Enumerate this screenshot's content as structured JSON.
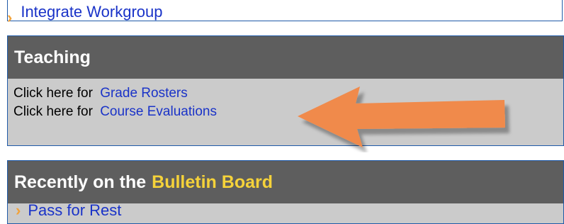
{
  "top": {
    "link": "Integrate Workgroup"
  },
  "teaching": {
    "title": "Teaching",
    "rows": [
      {
        "prefix": "Click here for",
        "link": "Grade Rosters"
      },
      {
        "prefix": "Click here for",
        "link": "Course Evaluations"
      }
    ]
  },
  "bulletin": {
    "title_prefix": "Recently on the",
    "title_highlight": "Bulletin Board",
    "peek": "Pass for Rest"
  },
  "colors": {
    "header_bg": "#5e5e5e",
    "section_bg": "#cbcbcb",
    "link": "#1a33c8",
    "highlight": "#f5d23a",
    "arrow": "#f08a4b",
    "border": "#1f5aa8"
  }
}
